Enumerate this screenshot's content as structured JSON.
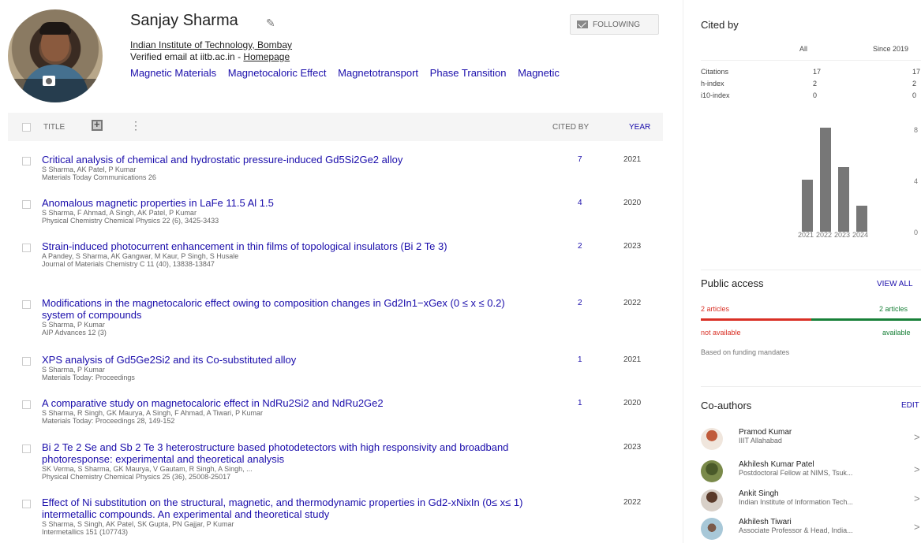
{
  "profile": {
    "name": "Sanjay Sharma",
    "affiliation": "Indian Institute of Technology, Bombay",
    "email_prefix": "Verified email at iitb.ac.in - ",
    "homepage_label": "Homepage",
    "interests": [
      "Magnetic Materials",
      "Magnetocaloric Effect",
      "Magnetotransport",
      "Phase Transition",
      "Magnetic"
    ],
    "follow_label": "FOLLOWING"
  },
  "table": {
    "title_label": "TITLE",
    "cited_by_label": "CITED BY",
    "year_label": "YEAR"
  },
  "articles": [
    {
      "title": "Critical analysis of chemical and hydrostatic pressure-induced Gd5Si2Ge2 alloy",
      "authors": "S Sharma, AK Patel, P Kumar",
      "venue": "Materials Today Communications 26",
      "cited": "7",
      "year": "2021"
    },
    {
      "title": "Anomalous magnetic properties in LaFe 11.5 Al 1.5",
      "authors": "S Sharma, F Ahmad, A Singh, AK Patel, P Kumar",
      "venue": "Physical Chemistry Chemical Physics 22 (6), 3425-3433",
      "cited": "4",
      "year": "2020"
    },
    {
      "title": "Strain-induced photocurrent enhancement in thin films of topological insulators (Bi 2 Te 3)",
      "authors": "A Pandey, S Sharma, AK Gangwar, M Kaur, P Singh, S Husale",
      "venue": "Journal of Materials Chemistry C 11 (40), 13838-13847",
      "cited": "2",
      "year": "2023"
    },
    {
      "title": "Modifications in the magnetocaloric effect owing to composition changes in Gd2In1−xGex (0 ≤ x ≤ 0.2) system of compounds",
      "authors": "S Sharma, P Kumar",
      "venue": "AIP Advances 12 (3)",
      "cited": "2",
      "year": "2022"
    },
    {
      "title": "XPS analysis of Gd5Ge2Si2 and its Co-substituted alloy",
      "authors": "S Sharma, P Kumar",
      "venue": "Materials Today: Proceedings",
      "cited": "1",
      "year": "2021"
    },
    {
      "title": "A comparative study on magnetocaloric effect in NdRu2Si2 and NdRu2Ge2",
      "authors": "S Sharma, R Singh, GK Maurya, A Singh, F Ahmad, A Tiwari, P Kumar",
      "venue": "Materials Today: Proceedings 28, 149-152",
      "cited": "1",
      "year": "2020"
    },
    {
      "title": "Bi 2 Te 2 Se and Sb 2 Te 3 heterostructure based photodetectors with high responsivity and broadband photoresponse: experimental and theoretical analysis",
      "authors": "SK Verma, S Sharma, GK Maurya, V Gautam, R Singh, A Singh, ...",
      "venue": "Physical Chemistry Chemical Physics 25 (36), 25008-25017",
      "cited": "",
      "year": "2023"
    },
    {
      "title": "Effect of Ni substitution on the structural, magnetic, and thermodynamic properties in Gd2-xNixIn (0≤ x≤ 1) intermetallic compounds. An experimental and theoretical study",
      "authors": "S Sharma, S Singh, AK Patel, SK Gupta, PN Gajjar, P Kumar",
      "venue": "Intermetallics 151 (107743)",
      "cited": "",
      "year": "2022"
    }
  ],
  "cited_by": {
    "title": "Cited by",
    "col_all": "All",
    "col_since": "Since 2019",
    "rows": [
      {
        "label": "Citations",
        "all": "17",
        "since": "17"
      },
      {
        "label": "h-index",
        "all": "2",
        "since": "2"
      },
      {
        "label": "i10-index",
        "all": "0",
        "since": "0"
      }
    ]
  },
  "chart_data": {
    "type": "bar",
    "categories": [
      "2021",
      "2022",
      "2023",
      "2024"
    ],
    "values": [
      4,
      8,
      5,
      2
    ],
    "ylim": [
      0,
      8
    ],
    "yticks": [
      "8",
      "4",
      "0"
    ],
    "bar_color": "#777777"
  },
  "public_access": {
    "title": "Public access",
    "view_all": "VIEW ALL",
    "left_count": "2 articles",
    "right_count": "2 articles",
    "not_available": "not available",
    "available": "available",
    "note": "Based on funding mandates",
    "not_available_color": "#d93025",
    "available_color": "#188038",
    "not_available_fraction": 0.5
  },
  "coauthors": {
    "title": "Co-authors",
    "edit": "EDIT",
    "list": [
      {
        "name": "Pramod Kumar",
        "affiliation": "IIIT Allahabad"
      },
      {
        "name": "Akhilesh Kumar Patel",
        "affiliation": "Postdoctoral Fellow at NIMS, Tsuk..."
      },
      {
        "name": "Ankit Singh",
        "affiliation": "Indian Institute of Information Tech..."
      },
      {
        "name": "Akhilesh Tiwari",
        "affiliation": "Associate Professor & Head, India..."
      }
    ]
  }
}
